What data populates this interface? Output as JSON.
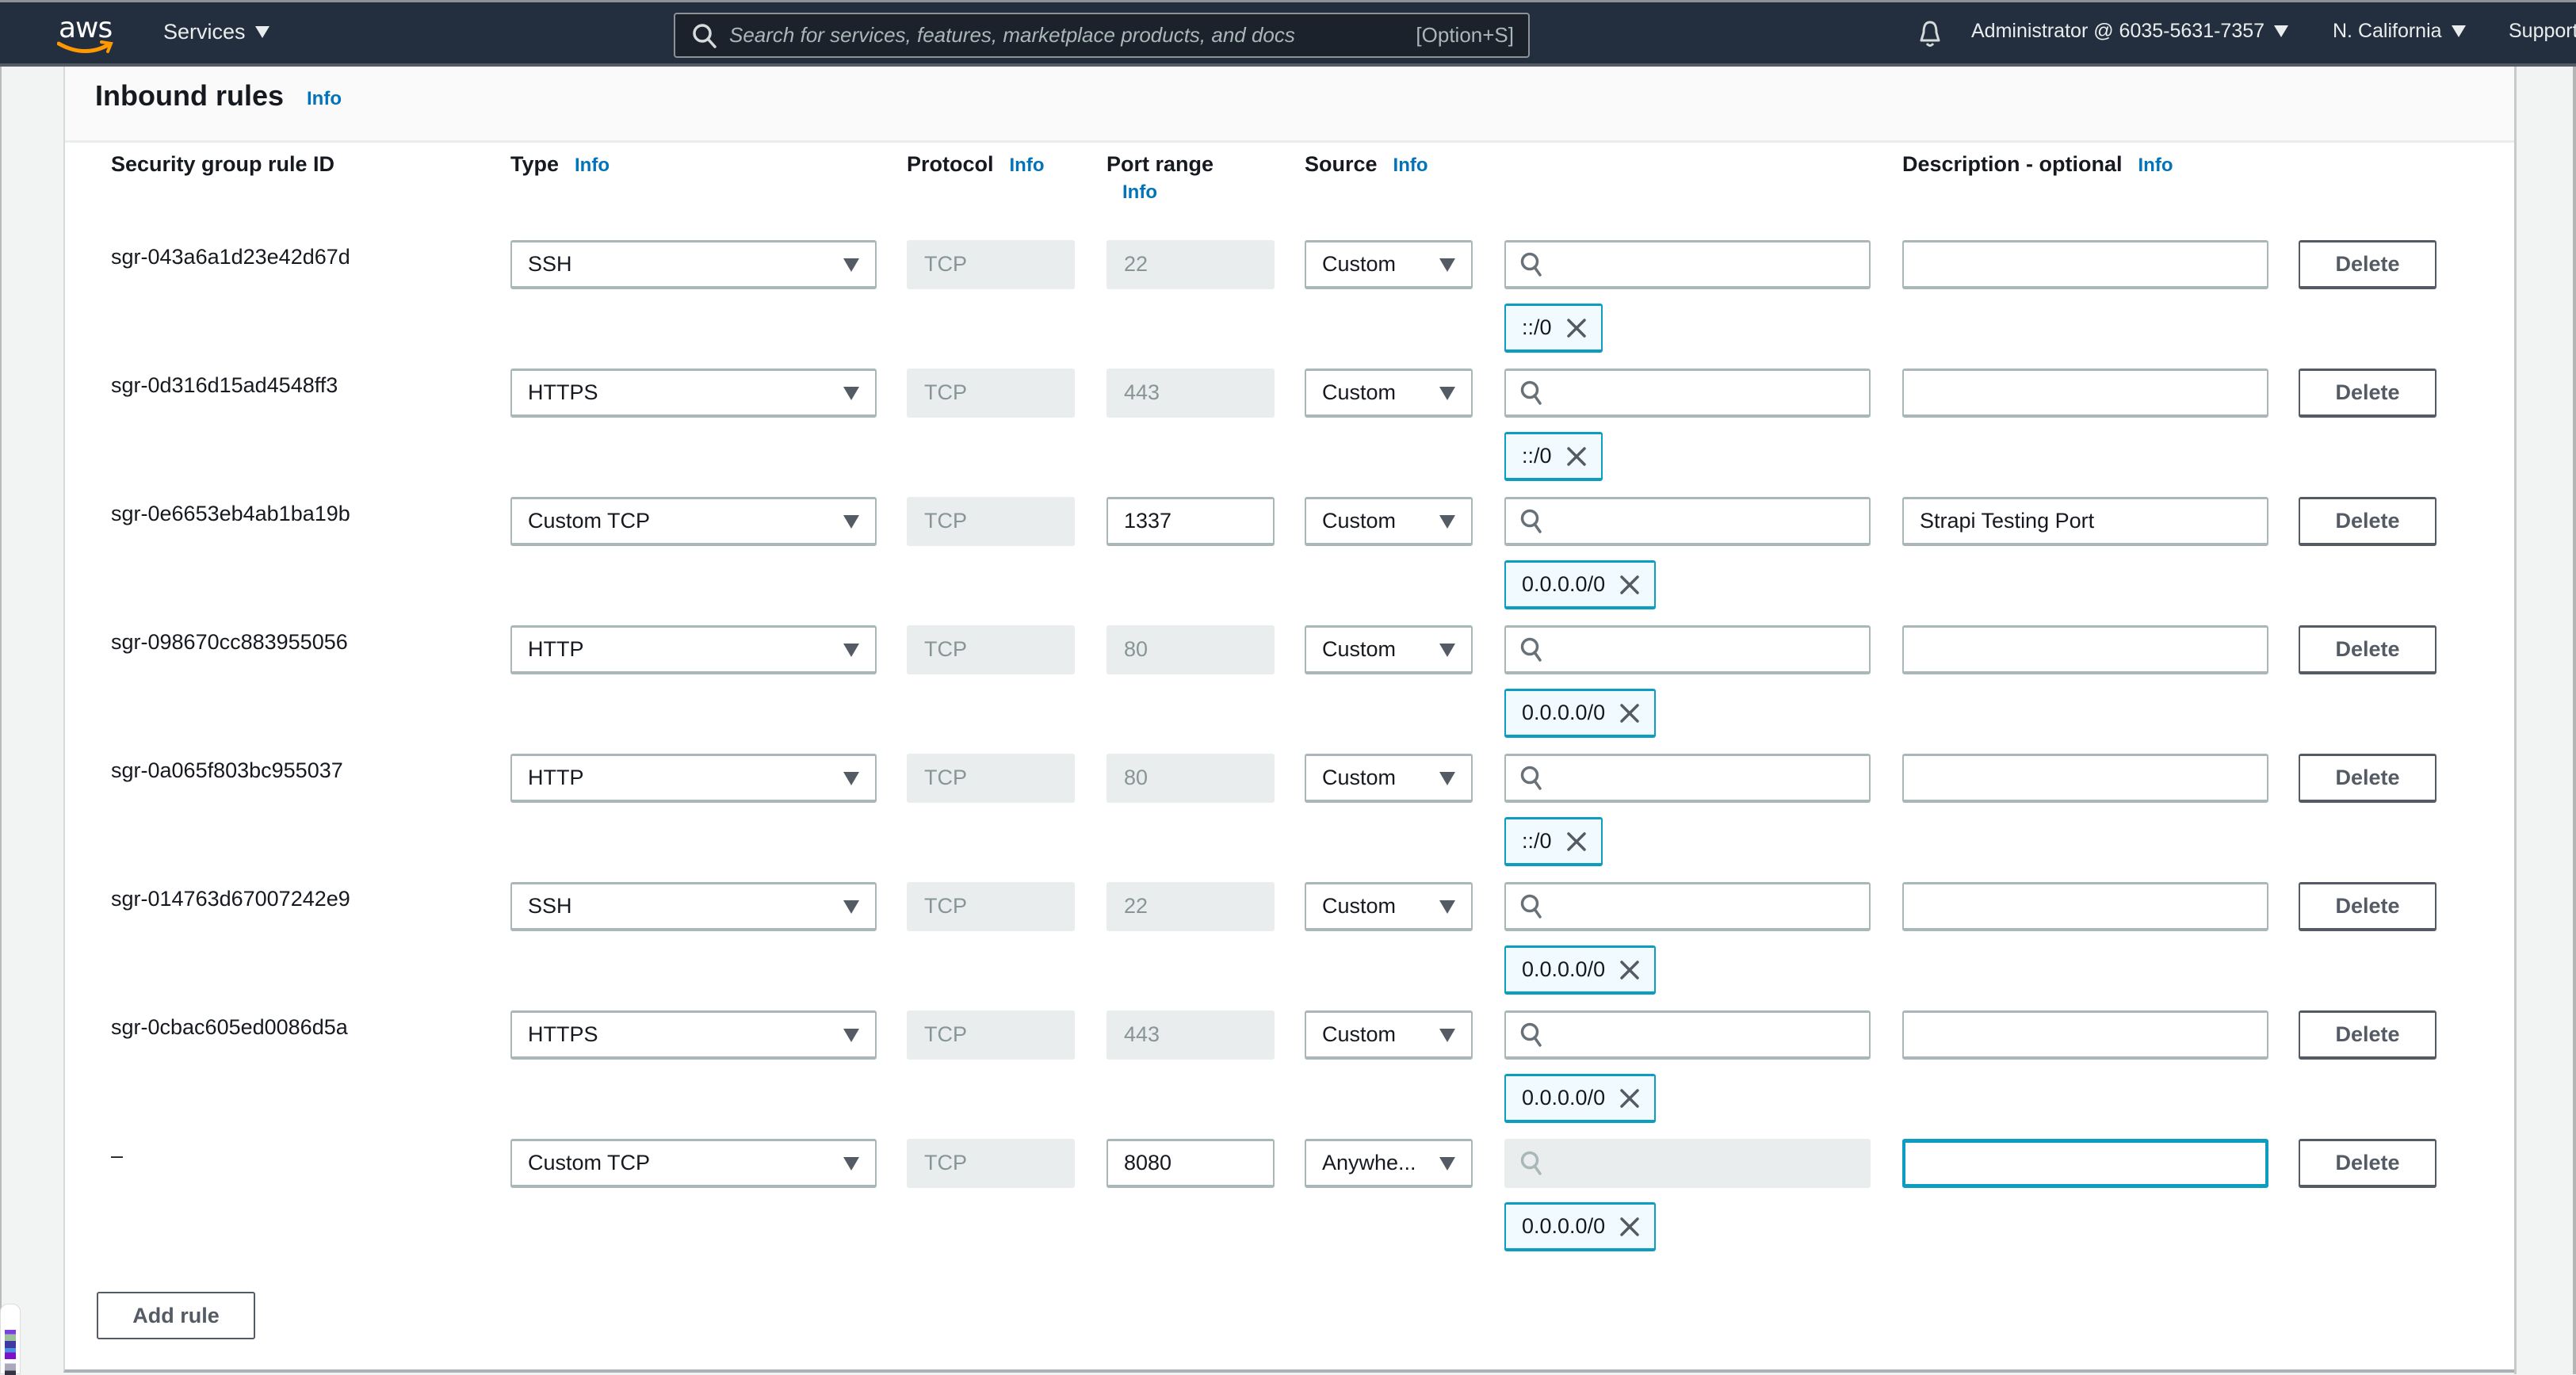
{
  "topbar": {
    "logo": "aws",
    "services_label": "Services",
    "search_placeholder": "Search for services, features, marketplace products, and docs",
    "search_shortcut": "[Option+S]",
    "account_label": "Administrator @ 6035-5631-7357",
    "region_label": "N. California",
    "support_label": "Support"
  },
  "panel": {
    "title": "Inbound rules",
    "info_label": "Info",
    "columns": {
      "rule_id": "Security group rule ID",
      "type": "Type",
      "protocol": "Protocol",
      "port_range": "Port range",
      "source": "Source",
      "description": "Description - optional"
    },
    "delete_label": "Delete",
    "add_rule_label": "Add rule"
  },
  "rules": [
    {
      "id": "sgr-043a6a1d23e42d67d",
      "type": "SSH",
      "protocol": "TCP",
      "port": "22",
      "port_editable": false,
      "source": "Custom",
      "source_search": "",
      "cidr": "::/0",
      "description": ""
    },
    {
      "id": "sgr-0d316d15ad4548ff3",
      "type": "HTTPS",
      "protocol": "TCP",
      "port": "443",
      "port_editable": false,
      "source": "Custom",
      "source_search": "",
      "cidr": "::/0",
      "description": ""
    },
    {
      "id": "sgr-0e6653eb4ab1ba19b",
      "type": "Custom TCP",
      "protocol": "TCP",
      "port": "1337",
      "port_editable": true,
      "source": "Custom",
      "source_search": "",
      "cidr": "0.0.0.0/0",
      "description": "Strapi Testing Port"
    },
    {
      "id": "sgr-098670cc883955056",
      "type": "HTTP",
      "protocol": "TCP",
      "port": "80",
      "port_editable": false,
      "source": "Custom",
      "source_search": "",
      "cidr": "0.0.0.0/0",
      "description": ""
    },
    {
      "id": "sgr-0a065f803bc955037",
      "type": "HTTP",
      "protocol": "TCP",
      "port": "80",
      "port_editable": false,
      "source": "Custom",
      "source_search": "",
      "cidr": "::/0",
      "description": ""
    },
    {
      "id": "sgr-014763d67007242e9",
      "type": "SSH",
      "protocol": "TCP",
      "port": "22",
      "port_editable": false,
      "source": "Custom",
      "source_search": "",
      "cidr": "0.0.0.0/0",
      "description": ""
    },
    {
      "id": "sgr-0cbac605ed0086d5a",
      "type": "HTTPS",
      "protocol": "TCP",
      "port": "443",
      "port_editable": false,
      "source": "Custom",
      "source_search": "",
      "cidr": "0.0.0.0/0",
      "description": ""
    },
    {
      "id": "–",
      "type": "Custom TCP",
      "protocol": "TCP",
      "port": "8080",
      "port_editable": true,
      "source": "Anywhe...",
      "source_search_disabled": true,
      "source_search": "",
      "cidr": "0.0.0.0/0",
      "description": "",
      "description_focused": true
    }
  ],
  "colors": {
    "topbar_bg": "#232f3e",
    "info_link": "#0073bb",
    "focus_accent": "#0c9dc0",
    "logo_smile": "#ff9900"
  }
}
